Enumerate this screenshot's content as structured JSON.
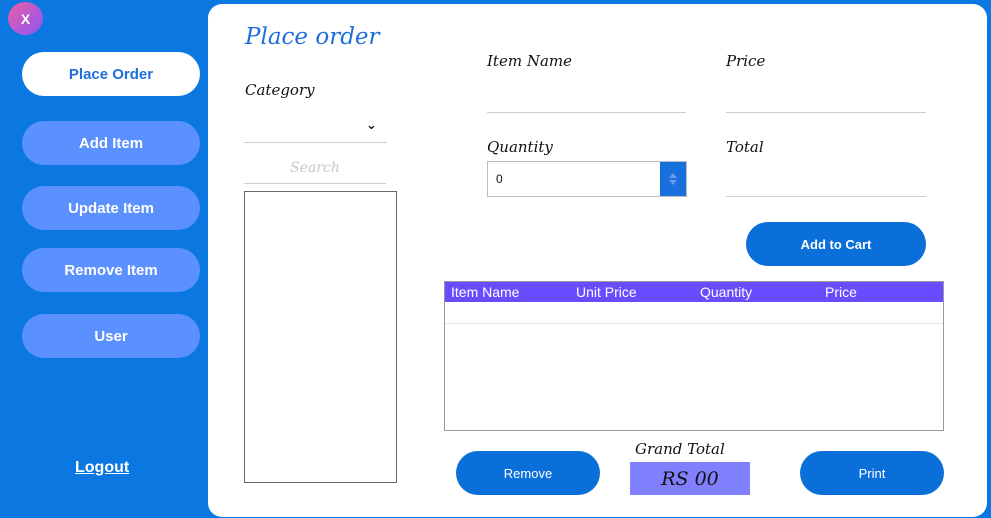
{
  "window": {
    "close_label": "X"
  },
  "sidebar": {
    "items": [
      {
        "label": "Place Order",
        "active": true
      },
      {
        "label": "Add Item",
        "active": false
      },
      {
        "label": "Update Item",
        "active": false
      },
      {
        "label": "Remove Item",
        "active": false
      },
      {
        "label": "User",
        "active": false
      }
    ],
    "logout_label": "Logout"
  },
  "main": {
    "title": "Place order",
    "category_label": "Category",
    "category_value": "",
    "search_placeholder": "Search",
    "item_name_label": "Item Name",
    "item_name_value": "",
    "price_label": "Price",
    "price_value": "",
    "quantity_label": "Quantity",
    "quantity_value": "0",
    "total_label": "Total",
    "total_value": "",
    "add_to_cart_label": "Add to Cart",
    "table": {
      "columns": [
        "Item Name",
        "Unit Price",
        "Quantity",
        "Price"
      ],
      "rows": []
    },
    "remove_label": "Remove",
    "print_label": "Print",
    "grand_total_label": "Grand Total",
    "grand_total_value": "RS 00"
  },
  "colors": {
    "background": "#0a78e0",
    "nav_button": "#5b90ff",
    "accent": "#1e6fdc",
    "table_header": "#6a4cff",
    "grand_total_box": "#8080ff"
  }
}
